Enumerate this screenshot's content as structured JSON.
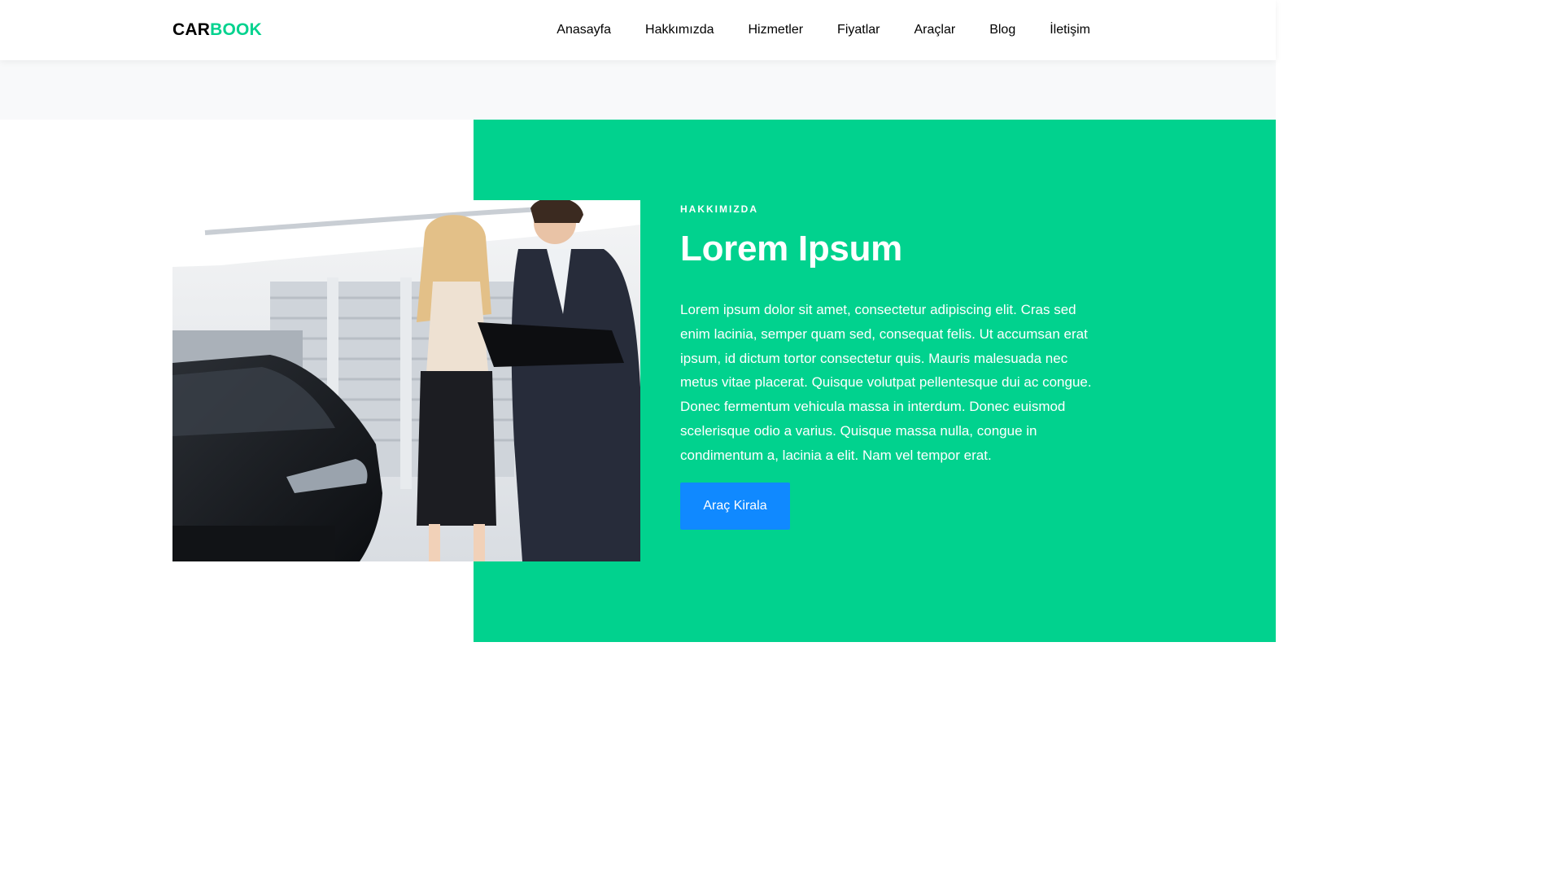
{
  "header": {
    "logo_part1": "CAR",
    "logo_part2": "BOOK",
    "nav": [
      {
        "label": "Anasayfa"
      },
      {
        "label": "Hakkımızda"
      },
      {
        "label": "Hizmetler"
      },
      {
        "label": "Fiyatlar"
      },
      {
        "label": "Araçlar"
      },
      {
        "label": "Blog"
      },
      {
        "label": "İletişim"
      }
    ]
  },
  "about": {
    "subheading": "HAKKIMIZDA",
    "heading": "Lorem Ipsum",
    "paragraph": "Lorem ipsum dolor sit amet, consectetur adipiscing elit. Cras sed enim lacinia, semper quam sed, consequat felis. Ut accumsan erat ipsum, id dictum tortor consectetur quis. Mauris malesuada nec metus vitae placerat. Quisque volutpat pellentesque dui ac congue. Donec fermentum vehicula massa in interdum. Donec euismod scelerisque odio a varius. Quisque massa nulla, congue in condimentum a, lacinia a elit. Nam vel tempor erat.",
    "button_label": "Araç Kirala",
    "image_icon": "showroom-photo"
  },
  "colors": {
    "accent_green": "#01d28e",
    "button_blue": "#1089ff",
    "strip_gray": "#f8f9fa"
  }
}
